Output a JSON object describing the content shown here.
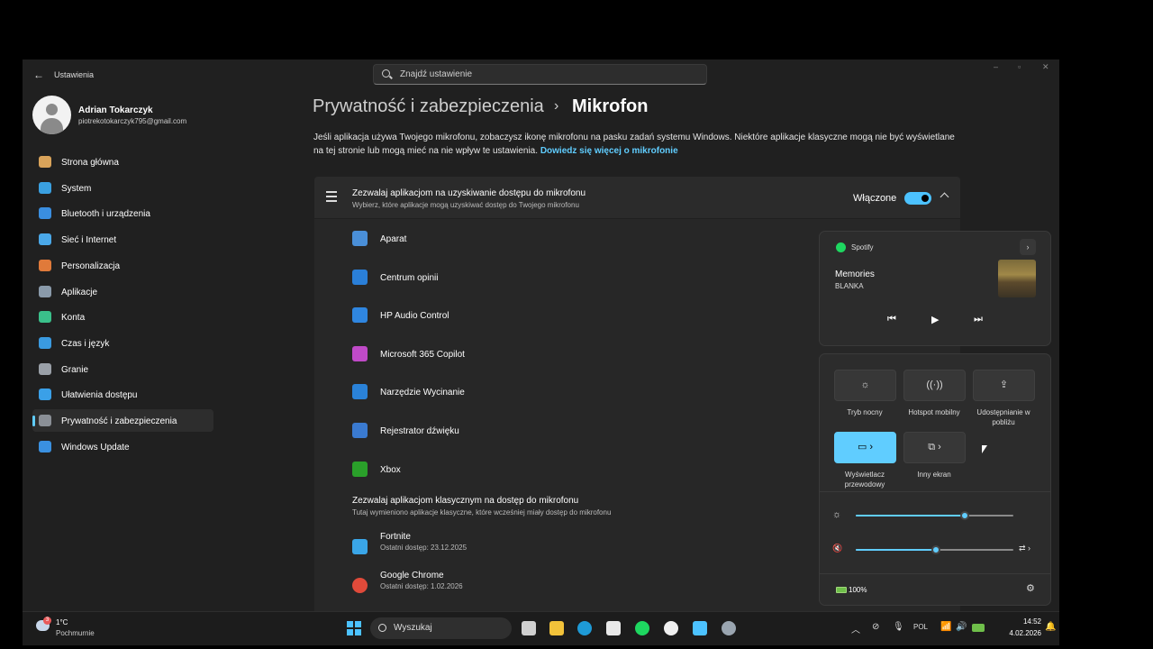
{
  "window": {
    "back_glyph": "←",
    "title": "Ustawienia",
    "search_placeholder": "Znajdź ustawienie",
    "controls": {
      "minimize": "–",
      "maximize": "▫",
      "close": "✕"
    }
  },
  "user": {
    "name": "Adrian Tokarczyk",
    "email": "piotrekotokarczyk795@gmail.com"
  },
  "sidebar": {
    "items": [
      {
        "label": "Strona główna",
        "icon": "home-icon",
        "color": "#d9a35a"
      },
      {
        "label": "System",
        "icon": "system-icon",
        "color": "#3aa0e0"
      },
      {
        "label": "Bluetooth i urządzenia",
        "icon": "bluetooth-icon",
        "color": "#3a8ee0"
      },
      {
        "label": "Sieć i Internet",
        "icon": "wifi-icon",
        "color": "#4aa8e8"
      },
      {
        "label": "Personalizacja",
        "icon": "brush-icon",
        "color": "#e07a3a"
      },
      {
        "label": "Aplikacje",
        "icon": "apps-icon",
        "color": "#8a9aaa"
      },
      {
        "label": "Konta",
        "icon": "account-icon",
        "color": "#3ac08a"
      },
      {
        "label": "Czas i język",
        "icon": "globe-icon",
        "color": "#3a9ae0"
      },
      {
        "label": "Granie",
        "icon": "gamepad-icon",
        "color": "#9aa0a8"
      },
      {
        "label": "Ułatwienia dostępu",
        "icon": "accessibility-icon",
        "color": "#3aa0e8"
      },
      {
        "label": "Prywatność i zabezpieczenia",
        "icon": "shield-icon",
        "color": "#8a8f96"
      },
      {
        "label": "Windows Update",
        "icon": "update-icon",
        "color": "#3a90e0"
      }
    ],
    "active_index": 10
  },
  "breadcrumb": {
    "parent": "Prywatność i zabezpieczenia",
    "separator": "›",
    "current": "Mikrofon"
  },
  "description": {
    "text": "Jeśli aplikacja używa Twojego mikrofonu, zobaczysz ikonę mikrofonu na pasku zadań systemu Windows. Niektóre aplikacje klasyczne mogą nie być wyświetlane na tej stronie lub mogą mieć na nie wpływ te ustawienia.",
    "link": "Dowiedz się więcej o mikrofonie"
  },
  "mic_access": {
    "title": "Zezwalaj aplikacjom na uzyskiwanie dostępu do mikrofonu",
    "subtitle": "Wybierz, które aplikacje mogą uzyskiwać dostęp do Twojego mikrofonu",
    "state": "Włączone"
  },
  "apps": [
    {
      "name": "Aparat",
      "icon": "camera-icon",
      "color": "#4a8fd8"
    },
    {
      "name": "Centrum opinii",
      "icon": "feedback-icon",
      "color": "#2a7fd8"
    },
    {
      "name": "HP Audio Control",
      "icon": "audio-icon",
      "color": "#2f86e0"
    },
    {
      "name": "Microsoft 365 Copilot",
      "icon": "copilot-icon",
      "color": "#c04ac8"
    },
    {
      "name": "Narzędzie Wycinanie",
      "icon": "snip-icon",
      "color": "#2a82d8"
    },
    {
      "name": "Rejestrator dźwięku",
      "icon": "recorder-icon",
      "color": "#3a7ad0"
    },
    {
      "name": "Xbox",
      "icon": "xbox-icon",
      "color": "#2aa02a"
    }
  ],
  "classic": {
    "title": "Zezwalaj aplikacjom klasycznym na dostęp do mikrofonu",
    "subtitle": "Tutaj wymieniono aplikacje klasyczne, które wcześniej miały dostęp do mikrofonu",
    "apps": [
      {
        "name": "Fortnite",
        "last": "Ostatni dostęp: 23.12.2025",
        "icon": "fortnite-icon",
        "color": "#3aa6e8"
      },
      {
        "name": "Google Chrome",
        "last": "Ostatni dostęp: 1.02.2026",
        "icon": "chrome-icon",
        "color": "#e04a3a"
      }
    ]
  },
  "media": {
    "app": "Spotify",
    "song": "Memories",
    "artist": "BLANKA",
    "more": "›",
    "prev": "⏮",
    "play": "▶",
    "next": "⏭"
  },
  "quick_settings": {
    "tiles": [
      {
        "label": "Tryb nocny",
        "glyph": "☼",
        "on": false
      },
      {
        "label": "Hotspot mobilny",
        "glyph": "((·))",
        "on": false
      },
      {
        "label": "Udostępnianie w pobliżu",
        "glyph": "⇪",
        "on": false
      },
      {
        "label": "Wyświetlacz przewodowy",
        "glyph": "▭ ›",
        "on": true
      },
      {
        "label": "Inny ekran",
        "glyph": "⧉ ›",
        "on": false
      }
    ],
    "brightness": 0.69,
    "volume": 0.51,
    "brightness_glyph": "☼",
    "volume_glyph": "🔇",
    "audio_glyph": "⇄ ›",
    "battery": "100%",
    "settings_glyph": "⚙"
  },
  "taskbar": {
    "temperature": "1°C",
    "weather": "Pochmurnie",
    "weather_badge": "3",
    "search": "Wyszukaj",
    "tray_chevron": "︿",
    "language": "POL",
    "time": "14:52",
    "date": "4.02.2026"
  }
}
